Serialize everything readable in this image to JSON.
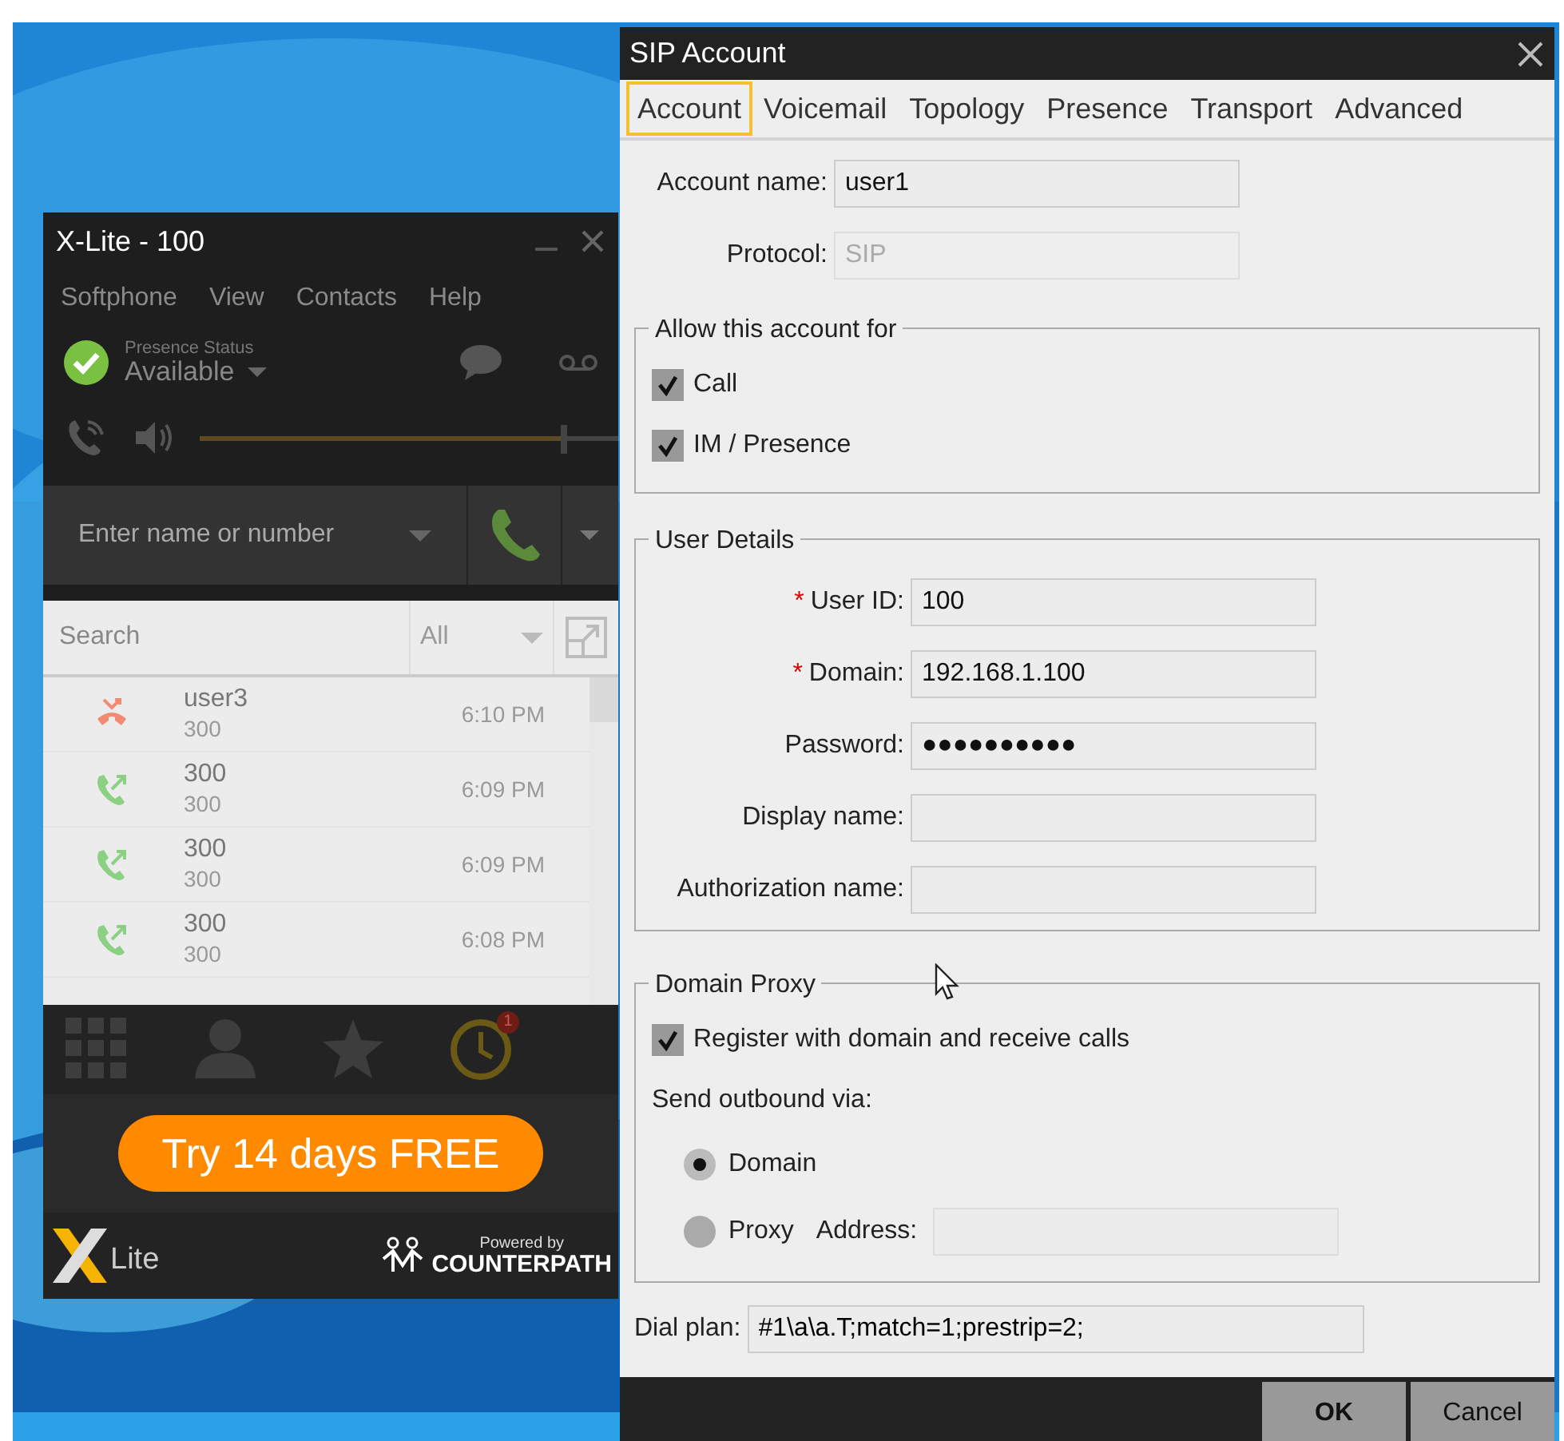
{
  "xlite": {
    "title": "X-Lite - 100",
    "menu": [
      "Softphone",
      "View",
      "Contacts",
      "Help"
    ],
    "presence": {
      "caption": "Presence Status",
      "status": "Available"
    },
    "volume": {
      "level": 0.87
    },
    "dial_field": {
      "placeholder": "Enter name or number"
    },
    "search_field": {
      "placeholder": "Search"
    },
    "filter": "All",
    "calls": [
      {
        "kind": "missed",
        "name": "user3",
        "number": "300",
        "time": "6:10 PM"
      },
      {
        "kind": "outgoing",
        "name": "300",
        "number": "300",
        "time": "6:09 PM"
      },
      {
        "kind": "outgoing",
        "name": "300",
        "number": "300",
        "time": "6:09 PM"
      },
      {
        "kind": "outgoing",
        "name": "300",
        "number": "300",
        "time": "6:08 PM"
      }
    ],
    "nav": [
      {
        "kind": "dialpad",
        "selected": false
      },
      {
        "kind": "contacts",
        "selected": false
      },
      {
        "kind": "favorites",
        "selected": false
      },
      {
        "kind": "history",
        "selected": true,
        "badge": "1"
      }
    ],
    "promo": "Try 14 days FREE",
    "footer": {
      "logo": "Lite",
      "powered_by": "Powered by",
      "brand": "COUNTERPATH"
    }
  },
  "dialog": {
    "title": "SIP Account",
    "tabs": [
      {
        "label": "Account",
        "selected": true
      },
      {
        "label": "Voicemail",
        "selected": false
      },
      {
        "label": "Topology",
        "selected": false
      },
      {
        "label": "Presence",
        "selected": false
      },
      {
        "label": "Transport",
        "selected": false
      },
      {
        "label": "Advanced",
        "selected": false
      }
    ],
    "account_name": {
      "label": "Account name:",
      "value": "user1"
    },
    "protocol": {
      "label": "Protocol:",
      "value": "SIP",
      "disabled": true
    },
    "allow": {
      "title": "Allow this account for",
      "options": [
        {
          "label": "Call",
          "checked": true
        },
        {
          "label": "IM / Presence",
          "checked": true
        }
      ]
    },
    "user_details": {
      "title": "User Details",
      "fields": [
        {
          "label": "User ID:",
          "required": true,
          "value": "100"
        },
        {
          "label": "Domain:",
          "required": true,
          "value": "192.168.1.100"
        },
        {
          "label": "Password:",
          "required": false,
          "value": "●●●●●●●●●●"
        },
        {
          "label": "Display name:",
          "required": false
        },
        {
          "label": "Authorization name:",
          "required": false
        }
      ],
      "required_mark": "*"
    },
    "domain_proxy": {
      "title": "Domain Proxy",
      "register": {
        "label": "Register with domain and receive calls",
        "checked": true
      },
      "outbound_label": "Send outbound via:",
      "routes": [
        {
          "label": "Domain",
          "selected": true
        },
        {
          "label": "Proxy",
          "selected": false
        }
      ],
      "address_label": "Address:"
    },
    "dial_plan": {
      "label": "Dial plan:",
      "value": "#1\\a\\a.T;match=1;prestrip=2;"
    },
    "buttons": [
      "OK",
      "Cancel"
    ]
  }
}
